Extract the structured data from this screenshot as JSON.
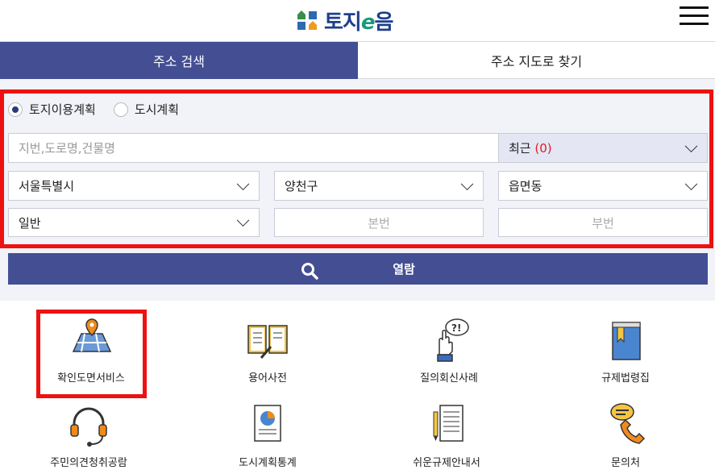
{
  "header": {
    "logo_text_a": "토지",
    "logo_text_e": "e",
    "logo_text_b": "음",
    "menu_icon": "hamburger-menu-icon"
  },
  "tabs": [
    {
      "label": "주소 검색",
      "active": true
    },
    {
      "label": "주소 지도로 찾기",
      "active": false
    }
  ],
  "search": {
    "radios": [
      {
        "label": "토지이용계획",
        "selected": true
      },
      {
        "label": "도시계획",
        "selected": false
      }
    ],
    "address_placeholder": "지번,도로명,건물명",
    "recent_label": "최근",
    "recent_count": "(0)",
    "sido": "서울특별시",
    "sigungu": "양천구",
    "dong": "읍면동",
    "land_type": "일반",
    "main_no_placeholder": "본번",
    "sub_no_placeholder": "부번",
    "view_button": "열람",
    "highlight_color": "#ee1111",
    "accent_color": "#434e93"
  },
  "services": [
    {
      "label": "확인도면서비스",
      "icon": "map-pin-icon"
    },
    {
      "label": "용어사전",
      "icon": "book-dictionary-icon"
    },
    {
      "label": "질의회신사례",
      "icon": "question-hand-icon"
    },
    {
      "label": "규제법령집",
      "icon": "law-book-icon"
    },
    {
      "label": "주민의견청취공람",
      "icon": "headset-icon"
    },
    {
      "label": "도시계획통계",
      "icon": "statistics-chart-icon"
    },
    {
      "label": "쉬운규제안내서",
      "icon": "guide-document-icon"
    },
    {
      "label": "문의처",
      "icon": "phone-chat-icon"
    }
  ]
}
